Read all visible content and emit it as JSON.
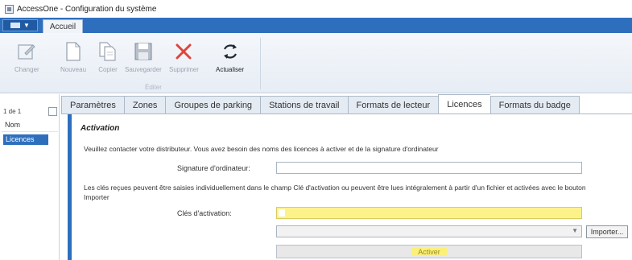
{
  "window": {
    "title": "AccessOne - Configuration du système"
  },
  "ribbon": {
    "tab": "Accueil",
    "buttons": {
      "changer": "Changer",
      "nouveau": "Nouveau",
      "copier": "Copier",
      "sauvegarder": "Sauvegarder",
      "supprimer": "Supprimer",
      "actualiser": "Actualiser"
    },
    "group_label": "Éditer"
  },
  "left_panel": {
    "pager": "1 de 1",
    "column_header": "Nom",
    "selected_item": "Licences"
  },
  "tabs": [
    "Paramètres",
    "Zones",
    "Groupes de parking",
    "Stations de travail",
    "Formats de lecteur",
    "Licences",
    "Formats du badge"
  ],
  "active_tab": "Licences",
  "activation": {
    "title": "Activation",
    "info": "Veuillez contacter votre distributeur. Vous avez besoin des noms des licences à activer et de la signature d'ordinateur",
    "signature_label": "Signature d'ordinateur:",
    "signature_value": "",
    "keys_info": "Les clés reçues peuvent être saisies individuellement dans le champ Clé d'activation ou peuvent être lues intégralement à partir d'un fichier et activées avec le bouton Importer",
    "keys_label": "Clés d'activation:",
    "keys_value": "",
    "import_button": "Importer...",
    "activate_button": "Activer"
  },
  "colors": {
    "accent": "#2e6fbd",
    "highlight": "#fdf28a",
    "delete_icon": "#e0443a"
  }
}
